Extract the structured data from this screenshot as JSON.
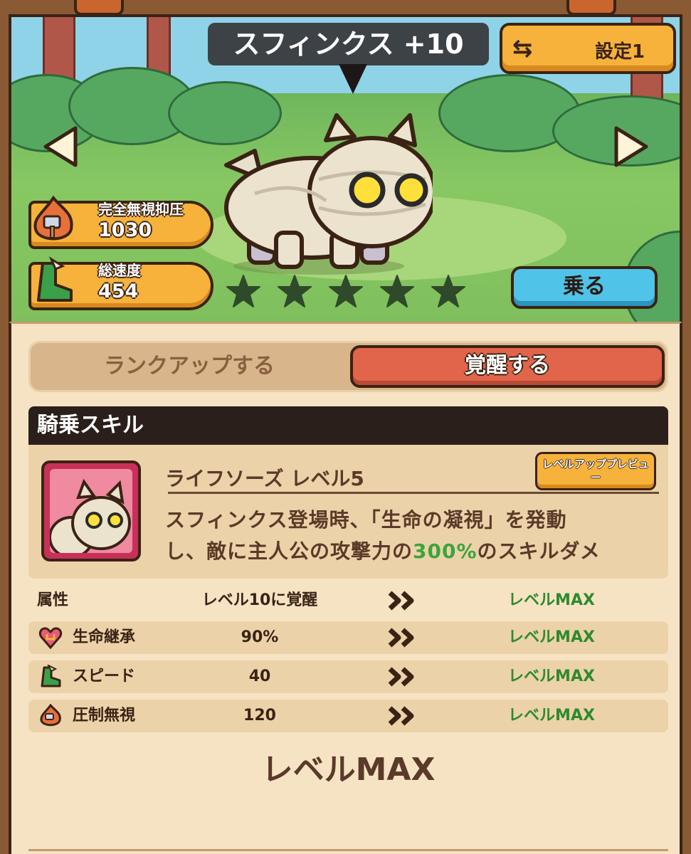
{
  "header": {
    "mount_name": "スフィンクス +10",
    "set_button_label": "設定1"
  },
  "stats": [
    {
      "label": "完全無視抑圧",
      "value": "1030",
      "icon": "suppression-ignore-icon"
    },
    {
      "label": "総速度",
      "value": "454",
      "icon": "speed-boot-icon"
    }
  ],
  "stars": {
    "filled": 0,
    "total": 5
  },
  "ride_button_label": "乗る",
  "tabs": {
    "rank_up": "ランクアップする",
    "awaken": "覚醒する",
    "active": "awaken"
  },
  "skill_section": {
    "header": "騎乗スキル",
    "skill_name": "ライフソーズ レベル5",
    "preview_button": "レベルアッププレビュー",
    "desc_line1": "スフィンクス登場時、「生命の凝視」を発動",
    "desc_line2_a": "し、敵に主人公の攻撃力の",
    "desc_line2_hl": "300%",
    "desc_line2_b": "のスキルダメ"
  },
  "attributes": {
    "header_name": "属性",
    "header_current": "レベル10に覚醒",
    "header_next": "レベルMAX",
    "rows": [
      {
        "name": "生命継承",
        "current": "90%",
        "next": "レベルMAX",
        "icon": "life-inherit-icon"
      },
      {
        "name": "スピード",
        "current": "40",
        "next": "レベルMAX",
        "icon": "speed-boot-icon"
      },
      {
        "name": "圧制無視",
        "current": "120",
        "next": "レベルMAX",
        "icon": "suppression-ignore-icon"
      }
    ]
  },
  "max_level_label": "レベルMAX",
  "colors": {
    "accent_orange": "#f6b23b",
    "awaken_red": "#e0654a",
    "ride_blue": "#4fc3e8",
    "green_text": "#2e8a2e",
    "dark_brown": "#3a2314"
  }
}
